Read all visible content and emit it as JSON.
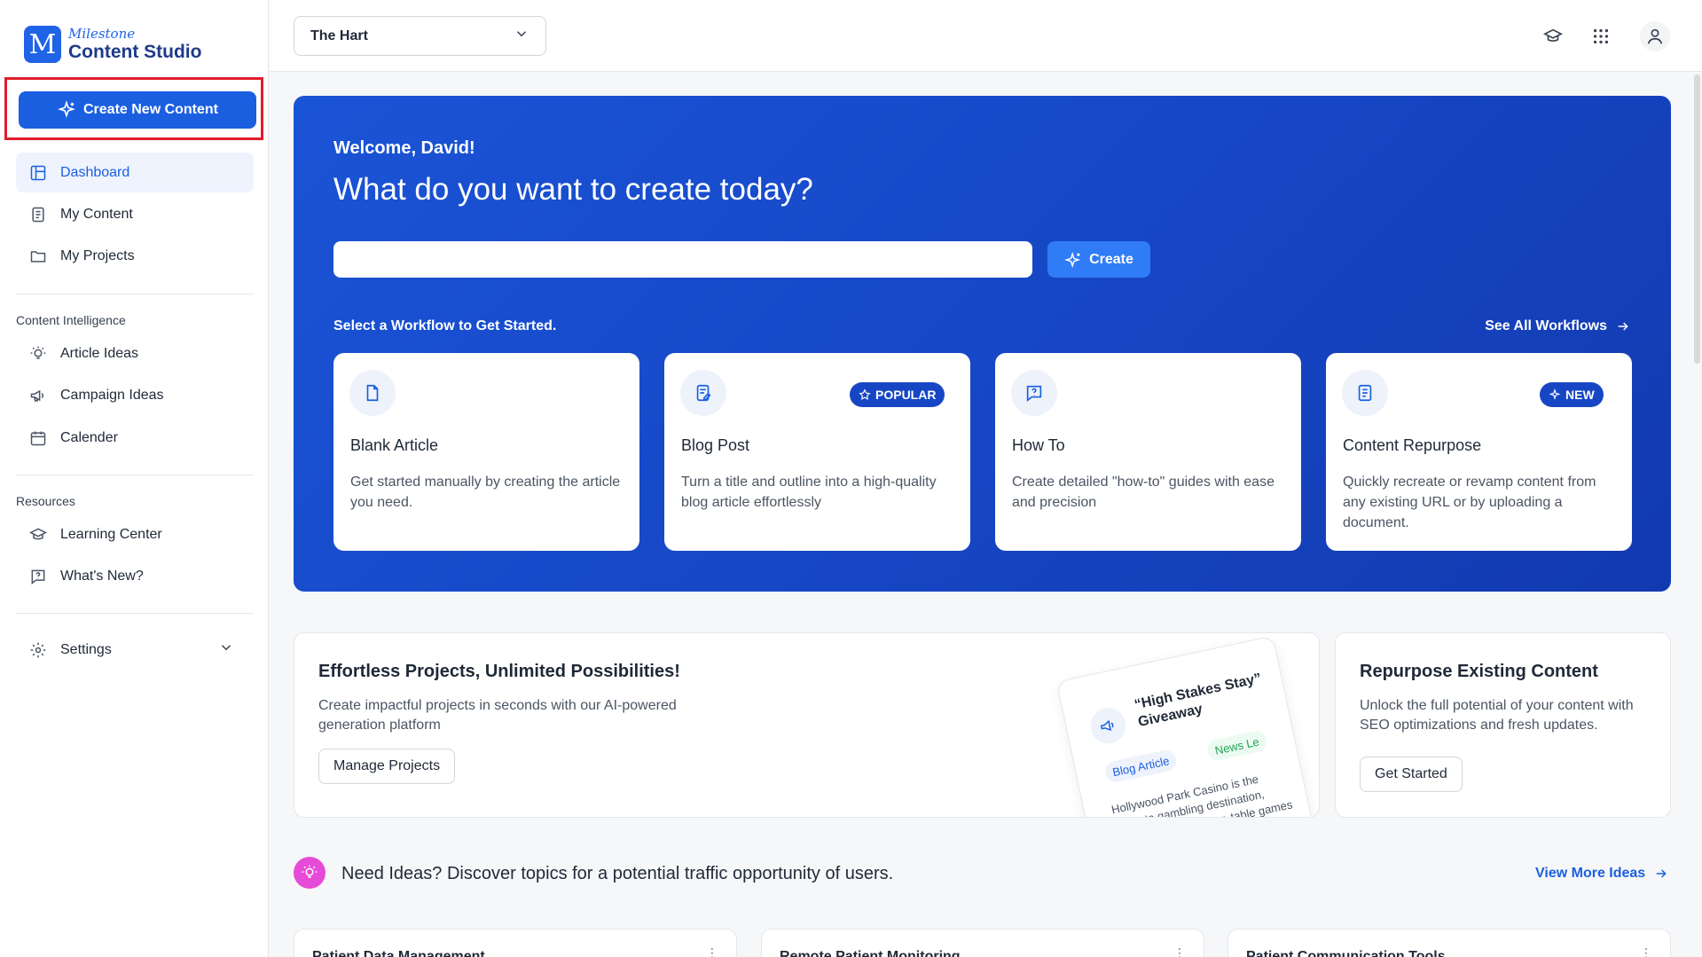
{
  "brand": {
    "line1": "Milestone",
    "line2": "Content Studio",
    "mark": "M"
  },
  "sidebar": {
    "create_label": "Create New Content",
    "nav": [
      {
        "label": "Dashboard",
        "icon": "layout-icon"
      },
      {
        "label": "My Content",
        "icon": "document-icon"
      },
      {
        "label": "My Projects",
        "icon": "folder-icon"
      }
    ],
    "section_intelligence": "Content Intelligence",
    "intelligence": [
      {
        "label": "Article Ideas",
        "icon": "lightbulb-icon"
      },
      {
        "label": "Campaign Ideas",
        "icon": "megaphone-icon"
      },
      {
        "label": "Calender",
        "icon": "calendar-icon"
      }
    ],
    "section_resources": "Resources",
    "resources": [
      {
        "label": "Learning Center",
        "icon": "graduation-cap-icon"
      },
      {
        "label": "What's New?",
        "icon": "question-bubble-icon"
      }
    ],
    "settings_label": "Settings"
  },
  "topbar": {
    "selected_site": "The Hart"
  },
  "hero": {
    "welcome": "Welcome, David!",
    "title": "What do you want to create today?",
    "input_value": "",
    "create_label": "Create",
    "subtitle": "Select a Workflow to Get Started.",
    "see_all": "See All Workflows"
  },
  "workflows": [
    {
      "title": "Blank Article",
      "desc": "Get started manually by creating the article you need.",
      "badge": ""
    },
    {
      "title": "Blog Post",
      "desc": "Turn a title and outline into a high-quality blog article effortlessly",
      "badge": "POPULAR"
    },
    {
      "title": "How To",
      "desc": "Create detailed \"how-to\" guides with ease and precision",
      "badge": ""
    },
    {
      "title": "Content Repurpose",
      "desc": "Quickly recreate or revamp content from any existing URL or by uploading a document.",
      "badge": "NEW"
    }
  ],
  "promo": {
    "title": "Effortless Projects, Unlimited Possibilities!",
    "desc": "Create impactful projects in seconds with our AI-powered generation platform",
    "button": "Manage Projects",
    "card_title": "“High Stakes Stay” Giveaway",
    "tag1": "Blog Article",
    "tag2": "News Le",
    "card_text": "Hollywood Park Casino is the ultimate gambling destination, offering top-tier poker, table games and thrilling casino"
  },
  "repurpose": {
    "title": "Repurpose Existing Content",
    "desc": "Unlock the full potential of your content with SEO optimizations and fresh updates.",
    "button": "Get Started"
  },
  "ideas": {
    "headline": "Need Ideas? Discover topics for a potential traffic opportunity of users.",
    "view_more": "View More Ideas",
    "cards": [
      "Patient Data Management",
      "Remote Patient Monitoring",
      "Patient Communication Tools"
    ]
  },
  "colors": {
    "accent": "#1a5fe0",
    "hero": "#1646c4",
    "highlight": "#e11d2a",
    "ideas": "#e54bd6"
  }
}
